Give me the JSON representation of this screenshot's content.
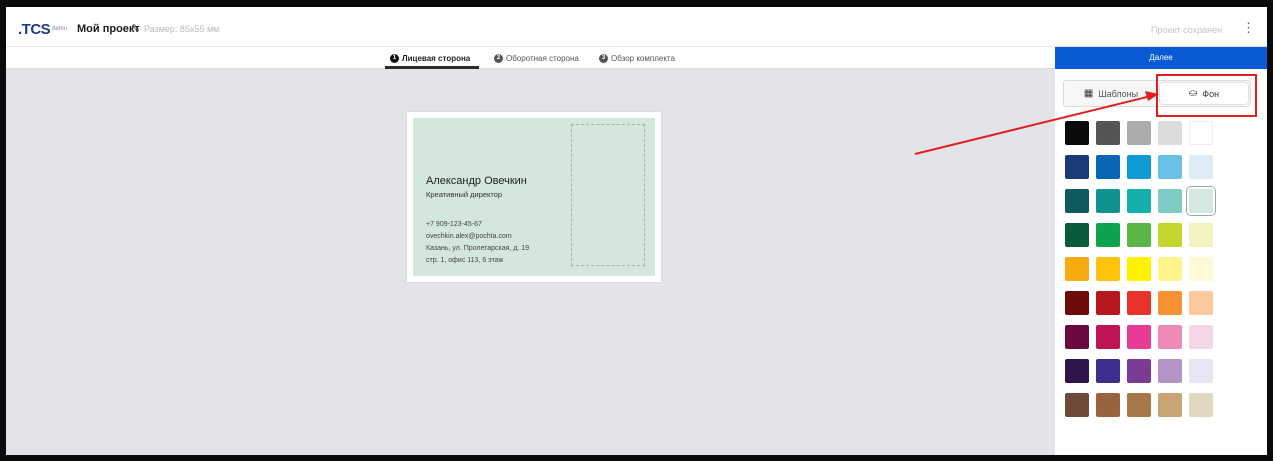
{
  "header": {
    "logo": ".TCS",
    "logo_badge": "demo",
    "project_name": "Мой проект",
    "size_label": "Размер: 85x55 мм",
    "saved_status": "Проект сохранен",
    "menu_icon": "more-vertical-icon"
  },
  "tabs": [
    {
      "num": "1",
      "label": "Лицевая сторона",
      "active": true
    },
    {
      "num": "2",
      "label": "Оборотная сторона",
      "active": false
    },
    {
      "num": "3",
      "label": "Обзор комплекта",
      "active": false
    }
  ],
  "panel": {
    "next_label": "Далее",
    "templates_label": "Шаблоны",
    "background_label": "Фон",
    "templates_icon": "grid-icon",
    "background_icon": "paint-bucket-icon",
    "swatches": [
      [
        "#0b0b0b",
        "#555555",
        "#ababab",
        "#dcdcdc",
        "#ffffff"
      ],
      [
        "#1b3a7a",
        "#0866b4",
        "#109bd6",
        "#69c1e5",
        "#dcedf6"
      ],
      [
        "#0e5a5f",
        "#119292",
        "#12afab",
        "#7ecdc5",
        "#d3e8de"
      ],
      [
        "#0a5b3a",
        "#0da44e",
        "#5ab546",
        "#c3d630",
        "#f3f3bf"
      ],
      [
        "#f7ab0e",
        "#ffc20c",
        "#fff200",
        "#fff58c",
        "#fff9d6"
      ],
      [
        "#6e0c0c",
        "#b5191f",
        "#e8332a",
        "#f79234",
        "#fccb9d"
      ],
      [
        "#6a0a3e",
        "#be1356",
        "#e73b95",
        "#ee8ab7",
        "#f5d6e6"
      ],
      [
        "#2e144b",
        "#3f2e8e",
        "#7a3b97",
        "#b494c7",
        "#e8e4f4"
      ],
      [
        "#6e4a3a",
        "#9a6340",
        "#a9784a",
        "#c9a474",
        "#e2d7c1"
      ]
    ],
    "selected_swatch": "#d3e8de"
  },
  "card": {
    "background": "#d3e7dd",
    "name": "Александр Овечкин",
    "title": "Креативный директор",
    "phone": "+7 909-123-45-67",
    "email": "ovechkin.alex@pochta.com",
    "address1": "Казань, ул. Пролетарская, д. 19",
    "address2": "стр. 1, офис 113, 6 этаж"
  },
  "colors": {
    "accent": "#0a5ad6",
    "annotation": "#e02020"
  }
}
